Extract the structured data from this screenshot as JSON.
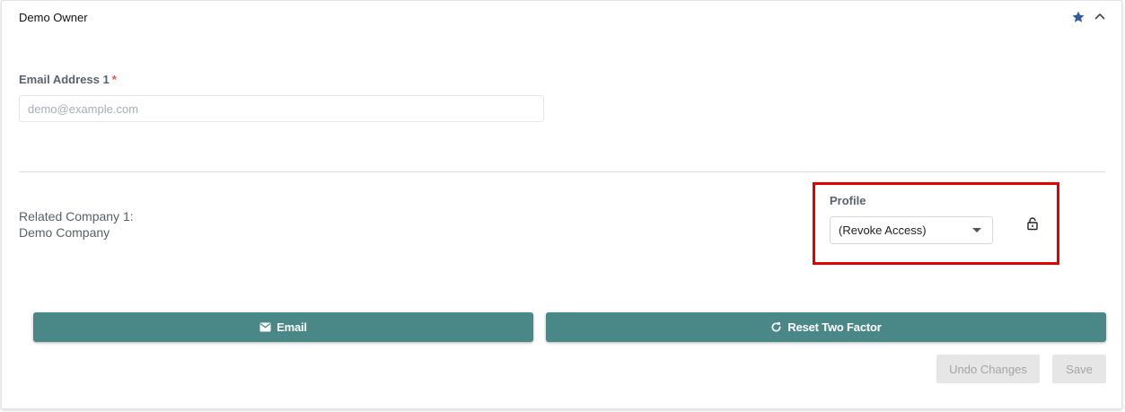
{
  "card": {
    "title": "Demo Owner"
  },
  "email_field": {
    "label": "Email Address 1",
    "required_mark": "*",
    "placeholder": "demo@example.com",
    "value": ""
  },
  "related_company": {
    "label": "Related Company 1:",
    "value": "Demo Company"
  },
  "profile": {
    "label": "Profile",
    "selected": "(Revoke Access)"
  },
  "buttons": {
    "email_label": "Email",
    "reset_two_factor_label": "Reset Two Factor",
    "undo_label": "Undo Changes",
    "save_label": "Save"
  },
  "icons": {
    "star": "star-icon",
    "collapse": "chevron-up-icon",
    "dropdown": "caret-down-icon",
    "lock": "lock-icon",
    "email": "envelope-icon",
    "reset": "refresh-icon"
  },
  "colors": {
    "primary_button": "#4a8787",
    "star": "#2f5d9e",
    "highlight": "#e00000",
    "required": "#d9534f",
    "disabled_bg": "#e6e6e6",
    "disabled_text": "#a5a5a5"
  }
}
